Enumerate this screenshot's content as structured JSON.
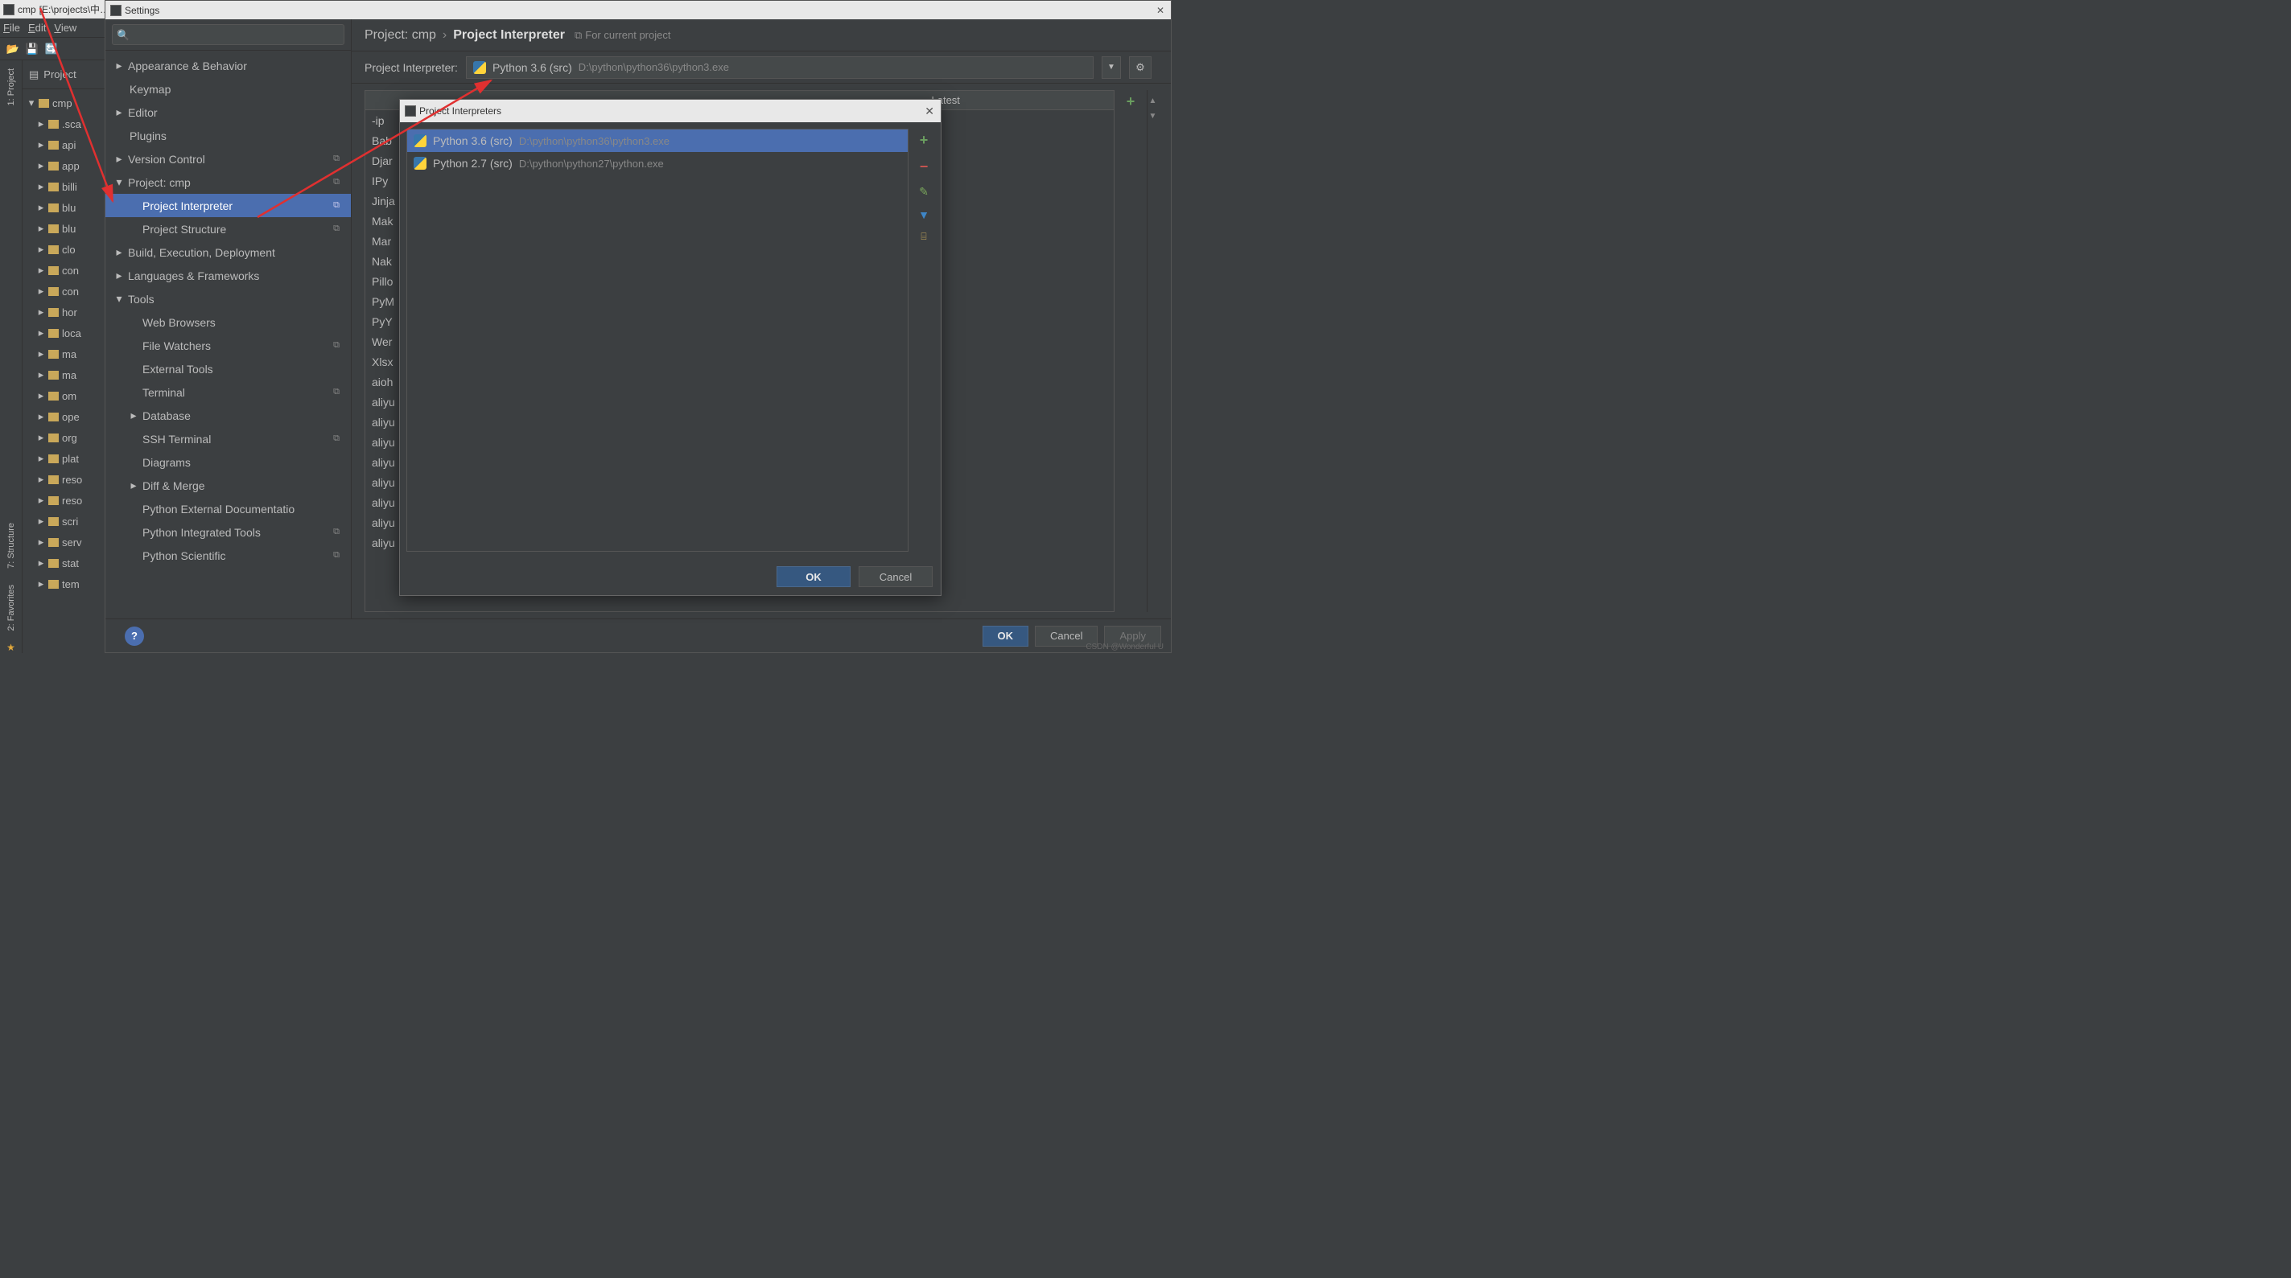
{
  "main_window": {
    "title_prefix": "cmp",
    "title_path": "[E:\\projects\\中…"
  },
  "menubar": [
    "File",
    "Edit",
    "View"
  ],
  "breadcrumb": "cmp",
  "left_tabs": {
    "project": "1: Project",
    "structure": "7: Structure",
    "favorites": "2: Favorites"
  },
  "project_header": "Project",
  "project_root": "cmp",
  "project_folders": [
    ".sca",
    "api",
    "app",
    "billi",
    "blu",
    "blu",
    "clo",
    "con",
    "con",
    "hor",
    "loca",
    "ma",
    "ma",
    "om",
    "ope",
    "org",
    "plat",
    "reso",
    "reso",
    "scri",
    "serv",
    "stat",
    "tem"
  ],
  "settings": {
    "title": "Settings",
    "search_placeholder": "",
    "tree": {
      "appearance": "Appearance & Behavior",
      "keymap": "Keymap",
      "editor": "Editor",
      "plugins": "Plugins",
      "vcs": "Version Control",
      "project": "Project: cmp",
      "project_interpreter": "Project Interpreter",
      "project_structure": "Project Structure",
      "bed": "Build, Execution, Deployment",
      "lang": "Languages & Frameworks",
      "tools": "Tools",
      "web_browsers": "Web Browsers",
      "file_watchers": "File Watchers",
      "external_tools": "External Tools",
      "terminal": "Terminal",
      "database": "Database",
      "ssh": "SSH Terminal",
      "diagrams": "Diagrams",
      "diff": "Diff & Merge",
      "pydoc": "Python External Documentatio",
      "pyint": "Python Integrated Tools",
      "pysci": "Python Scientific"
    },
    "crumb": {
      "project": "Project: cmp",
      "page": "Project Interpreter",
      "note": "For current project"
    },
    "interpreter": {
      "label": "Project Interpreter:",
      "name": "Python 3.6 (src)",
      "path": "D:\\python\\python36\\python3.exe"
    },
    "pkg_headers": {
      "latest": "Latest"
    },
    "packages": [
      "-ip",
      "Bab",
      "Djar",
      "IPy",
      "Jinja",
      "Mak",
      "Mar",
      "Nak",
      "Pillo",
      "PyM",
      "PyY",
      "Wer",
      "Xlsx",
      "aioh",
      "aliyu",
      "aliyu",
      "aliyu",
      "aliyu",
      "aliyu",
      "aliyu",
      "aliyu",
      "aliyu"
    ],
    "buttons": {
      "ok": "OK",
      "cancel": "Cancel",
      "apply": "Apply"
    }
  },
  "popup": {
    "title": "Project Interpreters",
    "items": [
      {
        "name": "Python 3.6 (src)",
        "path": "D:\\python\\python36\\python3.exe"
      },
      {
        "name": "Python 2.7 (src)",
        "path": "D:\\python\\python27\\python.exe"
      }
    ],
    "ok": "OK",
    "cancel": "Cancel"
  },
  "watermark": "CSDN @Wonderful    U"
}
